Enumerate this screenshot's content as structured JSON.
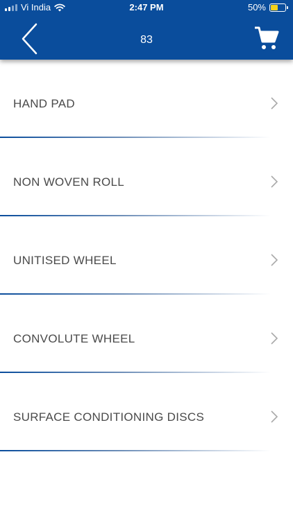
{
  "status_bar": {
    "carrier": "Vi India",
    "time": "2:47 PM",
    "battery_percent": "50%",
    "battery_level": 0.5,
    "battery_color": "#f5d21b"
  },
  "header": {
    "title": "83",
    "back_icon": "chevron-left-icon",
    "cart_icon": "shopping-cart-icon",
    "background": "#0a4d9c"
  },
  "items": [
    {
      "label": "HAND PAD"
    },
    {
      "label": "NON WOVEN ROLL"
    },
    {
      "label": "UNITISED WHEEL"
    },
    {
      "label": "CONVOLUTE WHEEL"
    },
    {
      "label": "SURFACE CONDITIONING DISCS"
    }
  ]
}
